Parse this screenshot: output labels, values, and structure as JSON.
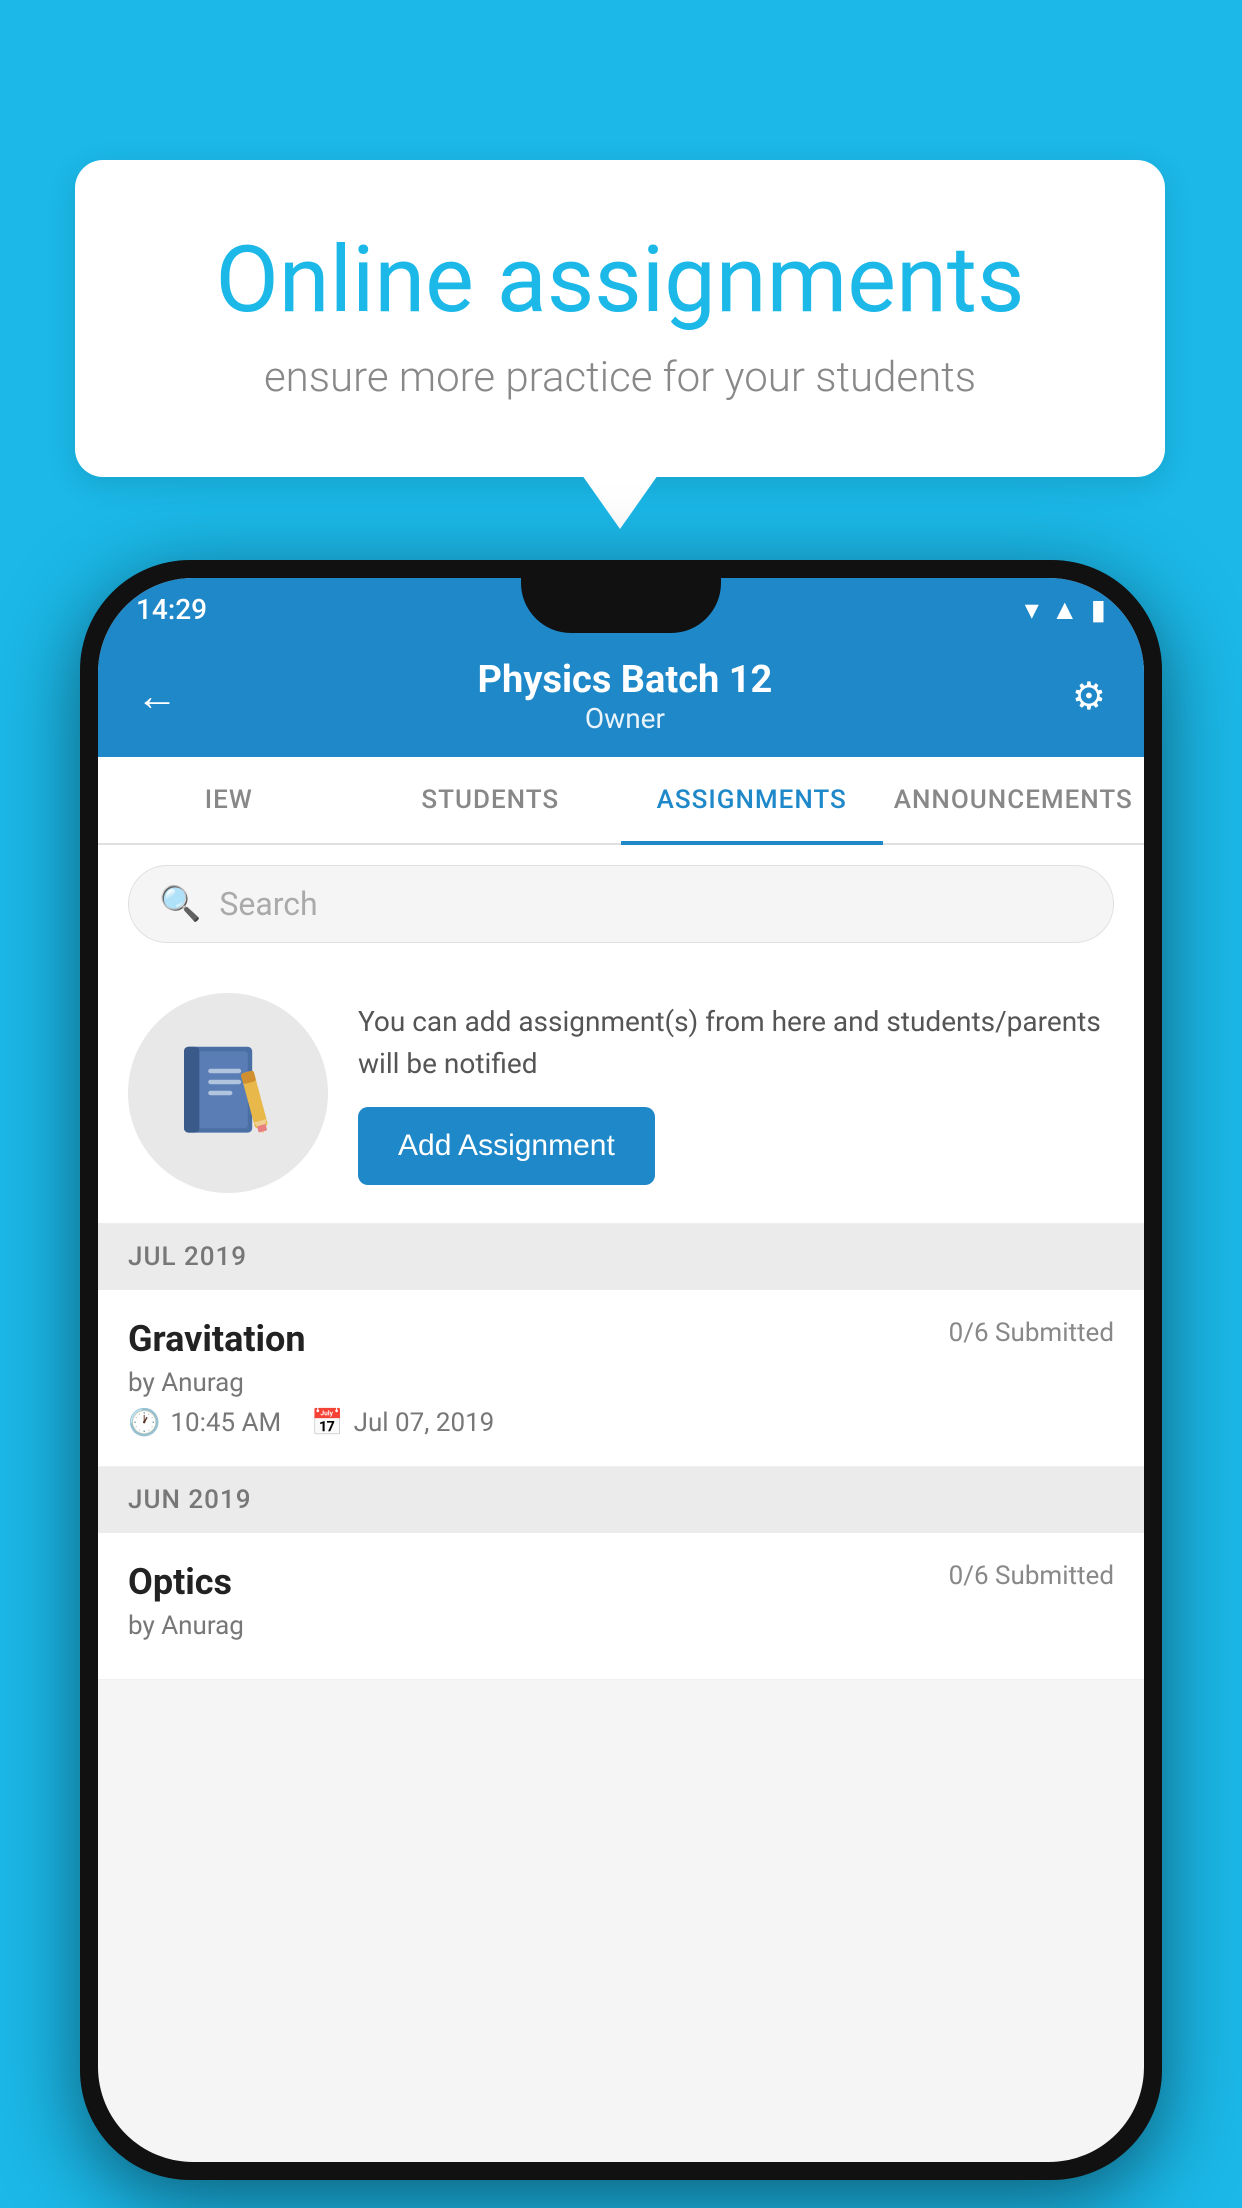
{
  "background": {
    "color": "#1BB8E8"
  },
  "promo": {
    "title": "Online assignments",
    "subtitle": "ensure more practice for your students"
  },
  "status_bar": {
    "time": "14:29"
  },
  "header": {
    "title": "Physics Batch 12",
    "subtitle": "Owner"
  },
  "tabs": [
    {
      "id": "iew",
      "label": "IEW"
    },
    {
      "id": "students",
      "label": "STUDENTS"
    },
    {
      "id": "assignments",
      "label": "ASSIGNMENTS",
      "active": true
    },
    {
      "id": "announcements",
      "label": "ANNOUNCEMENTS"
    }
  ],
  "search": {
    "placeholder": "Search"
  },
  "add_assignment_section": {
    "description": "You can add assignment(s) from here and students/parents will be notified",
    "button_label": "Add Assignment"
  },
  "months": [
    {
      "label": "JUL 2019",
      "assignments": [
        {
          "title": "Gravitation",
          "submitted": "0/6 Submitted",
          "author": "by Anurag",
          "time": "10:45 AM",
          "date": "Jul 07, 2019"
        }
      ]
    },
    {
      "label": "JUN 2019",
      "assignments": [
        {
          "title": "Optics",
          "submitted": "0/6 Submitted",
          "author": "by Anurag",
          "time": "",
          "date": ""
        }
      ]
    }
  ]
}
